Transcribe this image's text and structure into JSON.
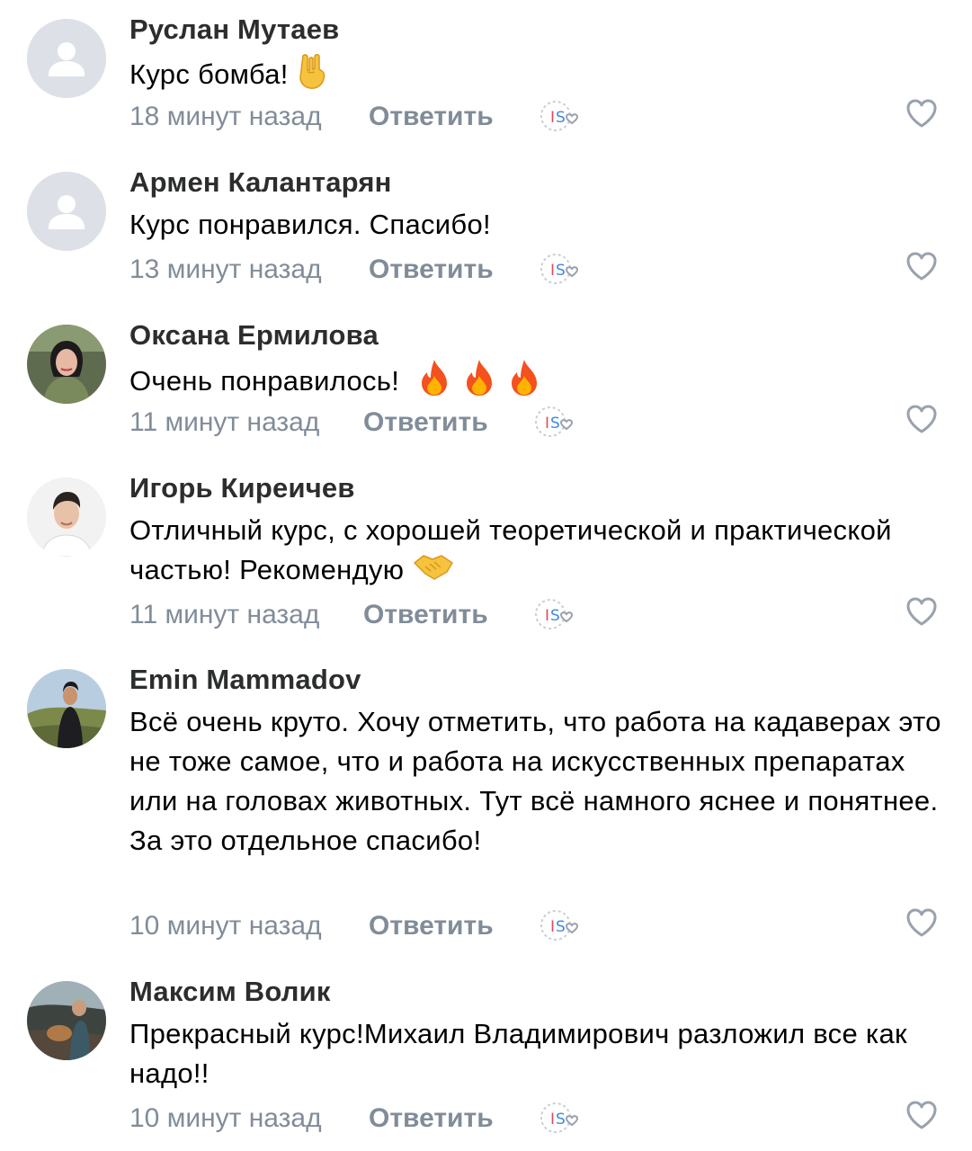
{
  "comments": [
    {
      "name": "Руслан Мутаев",
      "text": "Курс бомба!",
      "emoji": "rock-hand-icon",
      "time": "18 минут назад",
      "reply": "Ответить",
      "avatar": "default-avatar"
    },
    {
      "name": "Армен Калантарян",
      "text": "Курс понравился. Спасибо!",
      "time": "13 минут назад",
      "reply": "Ответить",
      "avatar": "default-avatar"
    },
    {
      "name": "Оксана Ермилова",
      "text": "Очень понравилось!",
      "emoji": "fire-icon ×3",
      "time": "11 минут назад",
      "reply": "Ответить",
      "avatar": "photo"
    },
    {
      "name": "Игорь Киреичев",
      "text": "Отличный курс, с хорошей теоретической и практической  частью! Рекомендую",
      "emoji": "handshake-icon",
      "time": "11 минут назад",
      "reply": "Ответить",
      "avatar": "photo"
    },
    {
      "name": "Emin Mammadov",
      "text": "Всё очень круто. Хочу отметить, что работа на кадаверах это не тоже самое, что и работа на искусственных препаратах или на головах животных. Тут всё намного яснее и понятнее. За это отдельное спасибо!",
      "time": "10 минут назад",
      "reply": "Ответить",
      "avatar": "photo"
    },
    {
      "name": "Максим Волик",
      "text": "Прекрасный курс!Михаил Владимирович разложил все как надо!!",
      "time": "10 минут назад",
      "reply": "Ответить",
      "avatar": "photo"
    }
  ],
  "colors": {
    "name": "#2c2d2e",
    "text": "#000000",
    "meta": "#818c99",
    "placeholder_avatar_bg": "#dde1e7",
    "placeholder_avatar_fg": "#ffffff",
    "like_icon": "#99a2ad"
  }
}
